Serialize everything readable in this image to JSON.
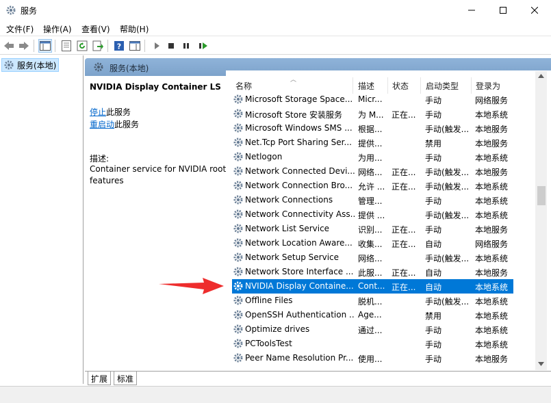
{
  "window": {
    "title": "服务"
  },
  "menu": [
    "文件(F)",
    "操作(A)",
    "查看(V)",
    "帮助(H)"
  ],
  "tree": {
    "item": "服务(本地)"
  },
  "panel": {
    "header": "服务(本地)",
    "selected_title": "NVIDIA Display Container LS",
    "stop_link": "停止",
    "stop_suffix": "此服务",
    "restart_link": "重启动",
    "restart_suffix": "此服务",
    "desc_label": "描述:",
    "desc_text": "Container service for NVIDIA root features"
  },
  "columns": {
    "name": "名称",
    "desc": "描述",
    "status": "状态",
    "startup": "启动类型",
    "logon": "登录为"
  },
  "rows": [
    {
      "name": "Microsoft Storage Space...",
      "desc": "Micr...",
      "status": "",
      "startup": "手动",
      "logon": "网络服务"
    },
    {
      "name": "Microsoft Store 安装服务",
      "desc": "为 M...",
      "status": "正在...",
      "startup": "手动",
      "logon": "本地系统"
    },
    {
      "name": "Microsoft Windows SMS ...",
      "desc": "根据...",
      "status": "",
      "startup": "手动(触发...",
      "logon": "本地服务"
    },
    {
      "name": "Net.Tcp Port Sharing Ser...",
      "desc": "提供...",
      "status": "",
      "startup": "禁用",
      "logon": "本地服务"
    },
    {
      "name": "Netlogon",
      "desc": "为用...",
      "status": "",
      "startup": "手动",
      "logon": "本地系统"
    },
    {
      "name": "Network Connected Devi...",
      "desc": "网络...",
      "status": "正在...",
      "startup": "手动(触发...",
      "logon": "本地服务"
    },
    {
      "name": "Network Connection Bro...",
      "desc": "允许 ...",
      "status": "正在...",
      "startup": "手动(触发...",
      "logon": "本地系统"
    },
    {
      "name": "Network Connections",
      "desc": "管理...",
      "status": "",
      "startup": "手动",
      "logon": "本地系统"
    },
    {
      "name": "Network Connectivity Ass...",
      "desc": "提供 ...",
      "status": "",
      "startup": "手动(触发...",
      "logon": "本地系统"
    },
    {
      "name": "Network List Service",
      "desc": "识别...",
      "status": "正在...",
      "startup": "手动",
      "logon": "本地服务"
    },
    {
      "name": "Network Location Aware...",
      "desc": "收集...",
      "status": "正在...",
      "startup": "自动",
      "logon": "网络服务"
    },
    {
      "name": "Network Setup Service",
      "desc": "网络...",
      "status": "",
      "startup": "手动(触发...",
      "logon": "本地系统"
    },
    {
      "name": "Network Store Interface ...",
      "desc": "此服...",
      "status": "正在...",
      "startup": "自动",
      "logon": "本地服务"
    },
    {
      "name": "NVIDIA Display Containe...",
      "desc": "Cont...",
      "status": "正在...",
      "startup": "自动",
      "logon": "本地系统"
    },
    {
      "name": "Offline Files",
      "desc": "脱机...",
      "status": "",
      "startup": "手动(触发...",
      "logon": "本地系统"
    },
    {
      "name": "OpenSSH Authentication ...",
      "desc": "Age...",
      "status": "",
      "startup": "禁用",
      "logon": "本地系统"
    },
    {
      "name": "Optimize drives",
      "desc": "通过...",
      "status": "",
      "startup": "手动",
      "logon": "本地系统"
    },
    {
      "name": "PCToolsTest",
      "desc": "",
      "status": "",
      "startup": "手动",
      "logon": "本地系统"
    },
    {
      "name": "Peer Name Resolution Pr...",
      "desc": "使用...",
      "status": "",
      "startup": "手动",
      "logon": "本地服务"
    }
  ],
  "selected_index": 13,
  "tabs": [
    "扩展",
    "标准"
  ],
  "colors": {
    "selection": "#0078d7",
    "header": "#7da3cb",
    "arrow": "#ee2d2d",
    "link": "#0066cc"
  }
}
